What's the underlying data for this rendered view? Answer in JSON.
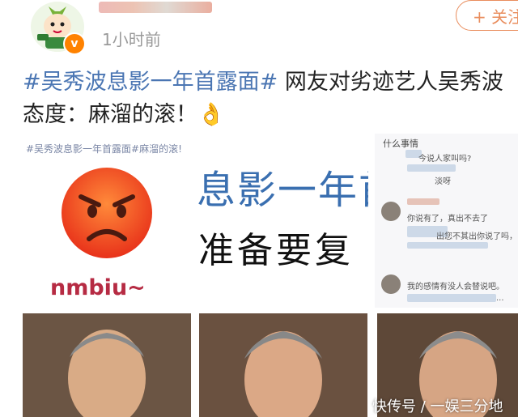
{
  "header": {
    "time": "1小时前",
    "verified_badge": "v",
    "follow_label": "+ 关注"
  },
  "post": {
    "topic": "#吴秀波息影一年首露面#",
    "body": " 网友对劣迹艺人吴秀波态度：麻溜的滚！",
    "emoji": "👌"
  },
  "images": {
    "img1": {
      "caption": "#吴秀波息影一年首露面#麻溜的滚!",
      "text": "nmbiu~",
      "emoji": "angry-face"
    },
    "img2": {
      "line1": "息影一年首",
      "line2": "准备要复"
    },
    "img3": {
      "title": "什么事情",
      "comments": [
        "今说人家叫吗?",
        "淡呀",
        "你说有了，真出不去了",
        "出您不其出你说了吗，...",
        "我的感情有没人会替说吧。",
        "..."
      ]
    }
  },
  "watermark": "快传号 / 一娱三分地",
  "colors": {
    "accent": "#e98d5d",
    "link": "#4b76b3",
    "badge": "#ff8200"
  },
  "icons": {
    "avatar": "cartoon-avatar",
    "verified": "verified-badge-icon"
  }
}
